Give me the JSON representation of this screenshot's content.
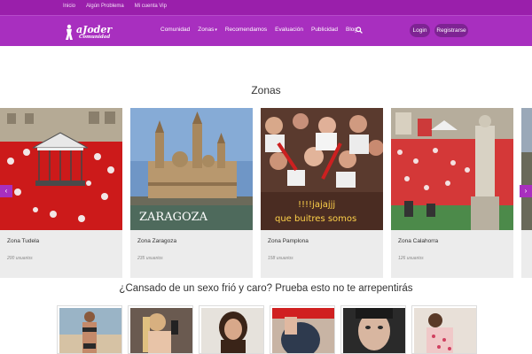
{
  "topbar": {
    "links": [
      "Inicio",
      "Algún Problema",
      "Mi cuenta Vip"
    ]
  },
  "header": {
    "logo_text": "aJoder",
    "logo_sub": "Comunidad",
    "nav": [
      "Comunidad",
      "Zonas",
      "Recomendamos",
      "Evaluación",
      "Publicidad",
      "Blog"
    ],
    "login_label": "Login",
    "register_label": "Registrarse"
  },
  "zonas": {
    "title": "Zonas",
    "cards": [
      {
        "name": "Zona Tudela",
        "users": "200 usuarios",
        "caption": ""
      },
      {
        "name": "Zona Zaragoza",
        "users": "235 usuarios",
        "caption": "ZARAGOZA"
      },
      {
        "name": "Zona Pamplona",
        "users": "158 usuarios",
        "caption_line1": "!!!!jajajjj",
        "caption_line2": "que buitres somos"
      },
      {
        "name": "Zona Calahorra",
        "users": "126 usuarios",
        "caption": ""
      }
    ]
  },
  "promo": {
    "title": "¿Cansado de un sexo frió y caro? Prueba esto no te arrepentirás"
  },
  "colors": {
    "brand": "#a82fbf",
    "brand_dark": "#9a1fab",
    "pill": "#7e2393"
  },
  "icons": [
    "search-icon",
    "chevron-left-icon",
    "chevron-right-icon",
    "logo-figure-icon"
  ]
}
